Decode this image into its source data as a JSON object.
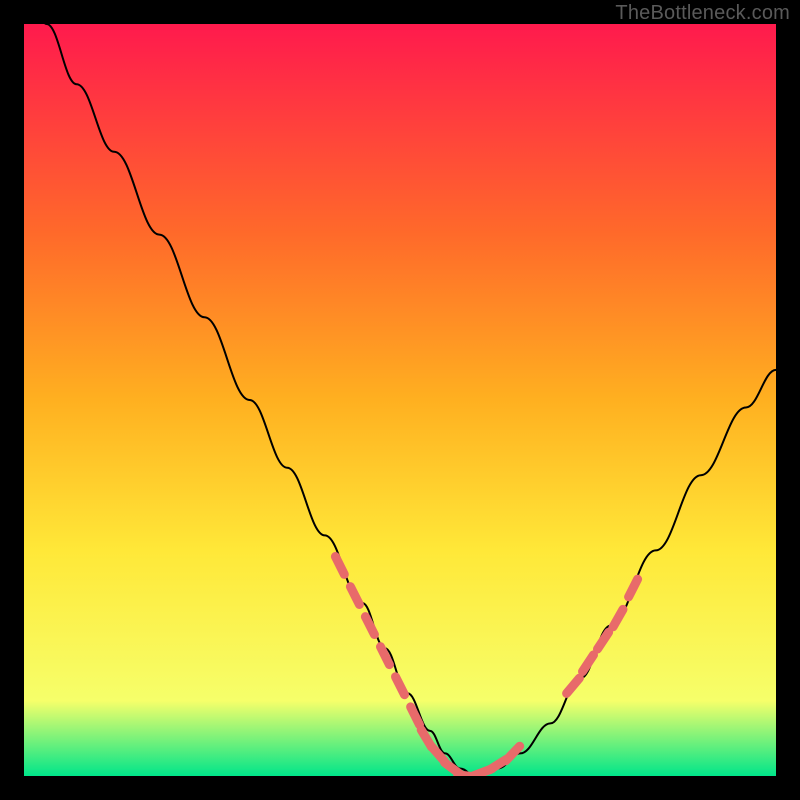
{
  "attribution": "TheBottleneck.com",
  "colors": {
    "background": "#000000",
    "gradient_top": "#ff1a4d",
    "gradient_mid1": "#ff6a2a",
    "gradient_mid2": "#ffb020",
    "gradient_mid3": "#ffe838",
    "gradient_low": "#f6ff6a",
    "gradient_bottom": "#00e58a",
    "curve": "#000000",
    "marker": "#e86a6a"
  },
  "chart_data": {
    "type": "line",
    "title": "",
    "xlabel": "",
    "ylabel": "",
    "xlim": [
      0,
      100
    ],
    "ylim": [
      0,
      100
    ],
    "grid": false,
    "legend": false,
    "series": [
      {
        "name": "bottleneck-curve",
        "x": [
          0,
          3,
          7,
          12,
          18,
          24,
          30,
          35,
          40,
          45,
          48,
          51,
          54,
          56,
          58,
          60,
          63,
          66,
          70,
          74,
          78,
          84,
          90,
          96,
          100
        ],
        "y": [
          107,
          100,
          92,
          83,
          72,
          61,
          50,
          41,
          32,
          23,
          17,
          11,
          6,
          3,
          1,
          0,
          1,
          3,
          7,
          13,
          20,
          30,
          40,
          49,
          54
        ]
      }
    ],
    "markers": {
      "name": "highlight-segments",
      "points": [
        {
          "x": 42,
          "y": 28
        },
        {
          "x": 44,
          "y": 24
        },
        {
          "x": 46,
          "y": 20
        },
        {
          "x": 48,
          "y": 16
        },
        {
          "x": 50,
          "y": 12
        },
        {
          "x": 52,
          "y": 8
        },
        {
          "x": 53.5,
          "y": 5
        },
        {
          "x": 55,
          "y": 3
        },
        {
          "x": 57,
          "y": 1
        },
        {
          "x": 59,
          "y": 0
        },
        {
          "x": 61,
          "y": 0.5
        },
        {
          "x": 63,
          "y": 1.5
        },
        {
          "x": 65,
          "y": 3
        },
        {
          "x": 73,
          "y": 12
        },
        {
          "x": 75,
          "y": 15
        },
        {
          "x": 77,
          "y": 18
        },
        {
          "x": 79,
          "y": 21
        },
        {
          "x": 81,
          "y": 25
        }
      ]
    }
  }
}
